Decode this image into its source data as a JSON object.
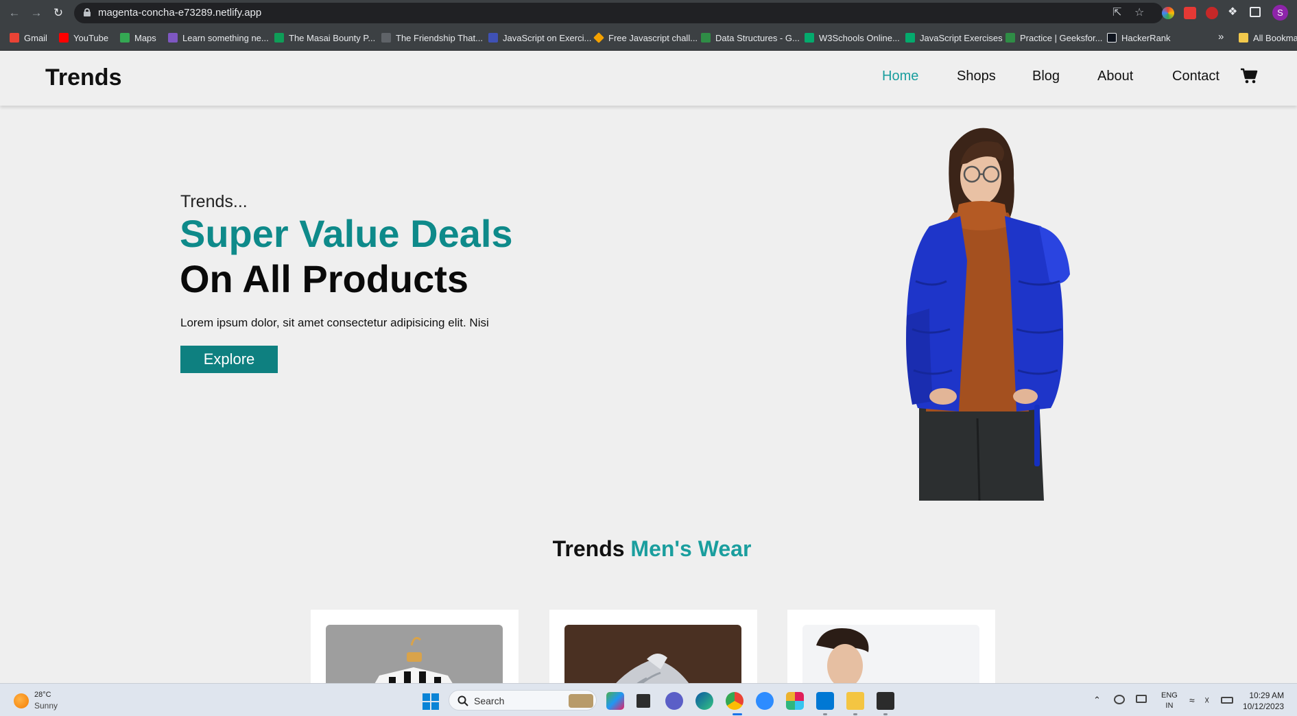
{
  "browser": {
    "url": "magenta-concha-e73289.netlify.app",
    "profile_initial": "S",
    "bookmarks": [
      {
        "label": "Gmail",
        "color": "#ea4335"
      },
      {
        "label": "YouTube",
        "color": "#ff0000"
      },
      {
        "label": "Maps",
        "color": "#34a853"
      },
      {
        "label": "Learn something ne...",
        "color": "#7e57c2"
      },
      {
        "label": "The Masai Bounty P...",
        "color": "#0f9d58"
      },
      {
        "label": "The Friendship That...",
        "color": "#5f6368"
      },
      {
        "label": "JavaScript on Exerci...",
        "color": "#3f51b5"
      },
      {
        "label": "Free Javascript chall...",
        "color": "#f4a100"
      },
      {
        "label": "Data Structures - G...",
        "color": "#2f8d46"
      },
      {
        "label": "W3Schools Online...",
        "color": "#04aa6d"
      },
      {
        "label": "JavaScript Exercises",
        "color": "#04aa6d"
      },
      {
        "label": "Practice | Geeksfor...",
        "color": "#2f8d46"
      },
      {
        "label": "HackerRank",
        "color": "#0e141e"
      }
    ],
    "bookmarks_overflow": "»",
    "all_bookmarks": "All Bookmarks"
  },
  "site": {
    "brand": "Trends",
    "nav": [
      "Home",
      "Shops",
      "Blog",
      "About",
      "Contact"
    ],
    "active_nav": "Home",
    "accent_color": "#1a9e9e"
  },
  "hero": {
    "subtitle": "Trends...",
    "headline_1": "Super Value Deals",
    "headline_2": "On All Products",
    "description": "Lorem ipsum dolor, sit amet consectetur adipisicing elit. Nisi",
    "button": "Explore"
  },
  "section": {
    "title_plain": "Trends",
    "title_accent": "Men's Wear"
  },
  "taskbar": {
    "weather_temp": "28°C",
    "weather_condition": "Sunny",
    "search_label": "Search",
    "lang_1": "ENG",
    "lang_2": "IN",
    "time": "10:29 AM",
    "date": "10/12/2023"
  }
}
